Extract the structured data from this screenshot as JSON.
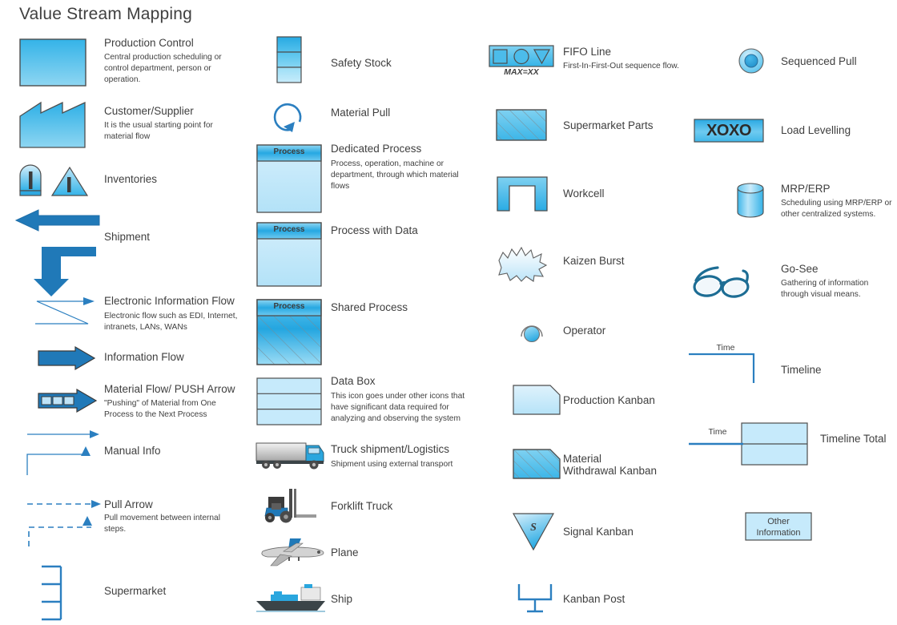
{
  "page": {
    "title": "Value Stream Mapping",
    "background": "#ffffff",
    "text_color": "#3f3f3f",
    "accent_blue": "#1f7bbf",
    "light_blue": "#bfe3f7",
    "fill_blue": "#3ab5e8",
    "stroke_gray": "#4d4d4d"
  },
  "columns": [
    {
      "id": "column-1",
      "items": [
        {
          "id": "production-control",
          "icon": "production-control-box-icon",
          "title": "Production Control",
          "desc": "Central production scheduling or\ncontrol department, person or\noperation."
        },
        {
          "id": "customer-supplier",
          "icon": "factory-icon",
          "title": "Customer/Supplier",
          "desc": "It is the usual starting point for\nmaterial flow"
        },
        {
          "id": "inventories",
          "icon": "inventories-icon",
          "title": "Inventories",
          "desc": ""
        },
        {
          "id": "shipment",
          "icon": "shipment-arrow-icon",
          "title": "Shipment",
          "desc": ""
        },
        {
          "id": "electronic-information-flow",
          "icon": "electronic-information-flow-icon",
          "title": "Electronic Information Flow",
          "desc": "Electronic flow such as EDI, Internet,\nintranets, LANs, WANs"
        },
        {
          "id": "information-flow",
          "icon": "information-flow-arrow-icon",
          "title": "Information Flow",
          "desc": ""
        },
        {
          "id": "material-flow-push-arrow",
          "icon": "push-arrow-icon",
          "title": "Material Flow/ PUSH Arrow",
          "desc": "\"Pushing\" of Material from One\nProcess to the Next Process"
        },
        {
          "id": "manual-info",
          "icon": "manual-info-icon",
          "title": "Manual Info",
          "desc": ""
        },
        {
          "id": "pull-arrow",
          "icon": "pull-arrow-icon",
          "title": "Pull Arrow",
          "desc": "Pull movement between internal\nsteps."
        },
        {
          "id": "supermarket",
          "icon": "supermarket-icon",
          "title": "Supermarket",
          "desc": ""
        }
      ]
    },
    {
      "id": "column-2",
      "items": [
        {
          "id": "safety-stock",
          "icon": "safety-stock-icon",
          "title": "Safety Stock",
          "desc": ""
        },
        {
          "id": "material-pull",
          "icon": "material-pull-icon",
          "title": "Material Pull",
          "desc": ""
        },
        {
          "id": "dedicated-process",
          "icon": "dedicated-process-icon",
          "icon_label": "Process",
          "title": "Dedicated Process",
          "desc": "Process, operation, machine or\ndepartment, through which material\nflows"
        },
        {
          "id": "process-with-data",
          "icon": "process-with-data-icon",
          "icon_label": "Process",
          "title": "Process with Data",
          "desc": ""
        },
        {
          "id": "shared-process",
          "icon": "shared-process-icon",
          "icon_label": "Process",
          "title": "Shared Process",
          "desc": ""
        },
        {
          "id": "data-box",
          "icon": "data-box-icon",
          "title": "Data Box",
          "desc": "This icon goes under other icons that\nhave significant data required for\nanalyzing and observing the system"
        },
        {
          "id": "truck-shipment-logistics",
          "icon": "truck-icon",
          "title": "Truck shipment/Logistics",
          "desc": "Shipment using external transport"
        },
        {
          "id": "forklift-truck",
          "icon": "forklift-icon",
          "title": "Forklift Truck",
          "desc": ""
        },
        {
          "id": "plane",
          "icon": "plane-icon",
          "title": "Plane",
          "desc": ""
        },
        {
          "id": "ship",
          "icon": "ship-icon",
          "title": "Ship",
          "desc": ""
        }
      ]
    },
    {
      "id": "column-3",
      "items": [
        {
          "id": "fifo-line",
          "icon": "fifo-line-icon",
          "icon_label": "MAX=XX",
          "title": "FIFO Line",
          "desc": "First-In-First-Out sequence flow."
        },
        {
          "id": "supermarket-parts",
          "icon": "supermarket-parts-icon",
          "title": "Supermarket Parts",
          "desc": ""
        },
        {
          "id": "workcell",
          "icon": "workcell-icon",
          "title": "Workcell",
          "desc": ""
        },
        {
          "id": "kaizen-burst",
          "icon": "kaizen-burst-icon",
          "title": "Kaizen Burst",
          "desc": ""
        },
        {
          "id": "operator",
          "icon": "operator-icon",
          "title": "Operator",
          "desc": ""
        },
        {
          "id": "production-kanban",
          "icon": "production-kanban-icon",
          "title": "Production Kanban",
          "desc": ""
        },
        {
          "id": "material-withdrawal-kanban",
          "icon": "material-withdrawal-kanban-icon",
          "title": "Material\nWithdrawal Kanban",
          "desc": ""
        },
        {
          "id": "signal-kanban",
          "icon": "signal-kanban-icon",
          "icon_label": "S",
          "title": "Signal Kanban",
          "desc": ""
        },
        {
          "id": "kanban-post",
          "icon": "kanban-post-icon",
          "title": "Kanban Post",
          "desc": ""
        }
      ]
    },
    {
      "id": "column-4",
      "items": [
        {
          "id": "sequenced-pull",
          "icon": "sequenced-pull-icon",
          "title": "Sequenced Pull",
          "desc": ""
        },
        {
          "id": "load-levelling",
          "icon": "load-levelling-icon",
          "icon_label": "XOXO",
          "title": "Load Levelling",
          "desc": ""
        },
        {
          "id": "mrp-erp",
          "icon": "mrp-erp-cylinder-icon",
          "title": "MRP/ERP",
          "desc": "Scheduling using MRP/ERP or\nother centralized systems."
        },
        {
          "id": "go-see",
          "icon": "glasses-icon",
          "title": "Go-See",
          "desc": "Gathering of information\nthrough visual means."
        },
        {
          "id": "timeline",
          "icon": "timeline-icon",
          "icon_label": "Time",
          "title": "Timeline",
          "desc": ""
        },
        {
          "id": "timeline-total",
          "icon": "timeline-total-icon",
          "icon_label": "Time",
          "title": "Timeline Total",
          "desc": ""
        },
        {
          "id": "other-information",
          "icon": "other-information-box-icon",
          "icon_label": "Other\nInformation",
          "title": "",
          "desc": ""
        }
      ]
    }
  ]
}
